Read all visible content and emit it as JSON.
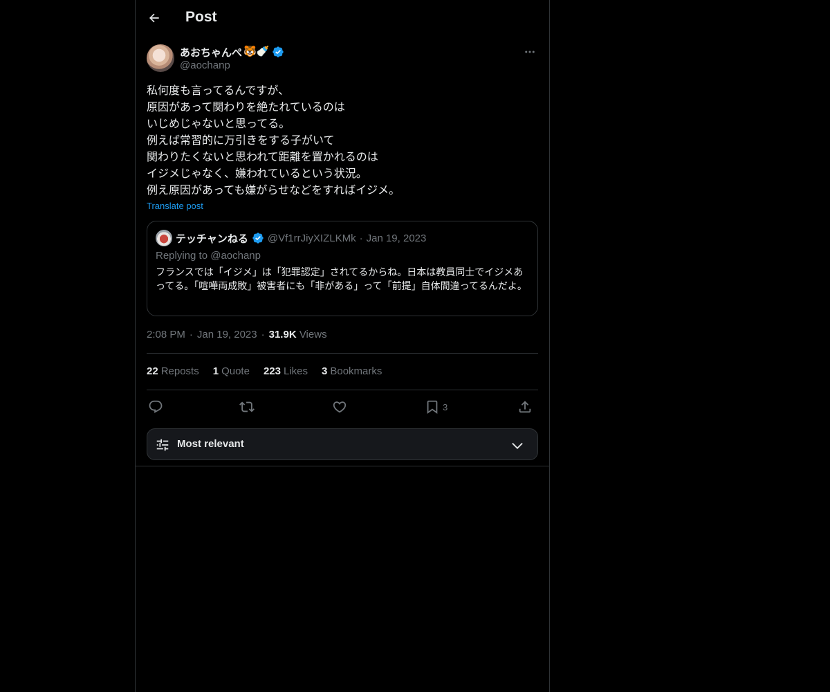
{
  "header": {
    "title": "Post"
  },
  "post": {
    "author": {
      "name": "あおちゃんぺ",
      "emojis": "🐯🍼",
      "handle": "@aochanp",
      "verified": true
    },
    "text_lines": [
      "私何度も言ってるんですが、",
      "原因があって関わりを絶たれているのは",
      "いじめじゃないと思ってる。",
      "例えば常習的に万引きをする子がいて",
      "関わりたくないと思われて距離を置かれるのは",
      "イジメじゃなく、嫌われているという状況。",
      "例え原因があっても嫌がらせなどをすればイジメ。"
    ],
    "translate_label": "Translate post",
    "quote": {
      "author_name": "テッチャンねる",
      "handle": "@Vf1rrJiyXIZLKMk",
      "separator": "·",
      "date": "Jan 19, 2023",
      "replying_to": "Replying to @aochanp",
      "text": "フランスでは「イジメ」は「犯罪認定」されてるからね。日本は教員同士でイジメあってる。「喧嘩両成敗」被害者にも「非がある」って「前提」自体間違ってるんだよ。"
    },
    "meta": {
      "time": "2:08 PM",
      "separator": "·",
      "date": "Jan 19, 2023",
      "views_count": "31.9K",
      "views_label": "Views"
    },
    "stats": {
      "reposts_count": "22",
      "reposts_label": "Reposts",
      "quotes_count": "1",
      "quotes_label": "Quote",
      "likes_count": "223",
      "likes_label": "Likes",
      "bookmarks_count": "3",
      "bookmarks_label": "Bookmarks"
    },
    "actions": {
      "bookmark_count": "3"
    }
  },
  "replies_sort": {
    "label": "Most relevant"
  },
  "colors": {
    "background": "#000000",
    "text_primary": "#e7e9ea",
    "text_secondary": "#71767b",
    "accent": "#1d9bf0",
    "border": "#2f3336"
  },
  "icons": {
    "back": "arrow-left-icon",
    "more": "ellipsis-icon",
    "verified": "verified-badge-icon",
    "reply": "reply-icon",
    "repost": "repost-icon",
    "like": "heart-icon",
    "bookmark": "bookmark-icon",
    "share": "share-icon",
    "sort": "sliders-icon",
    "chevron": "chevron-down-icon"
  }
}
